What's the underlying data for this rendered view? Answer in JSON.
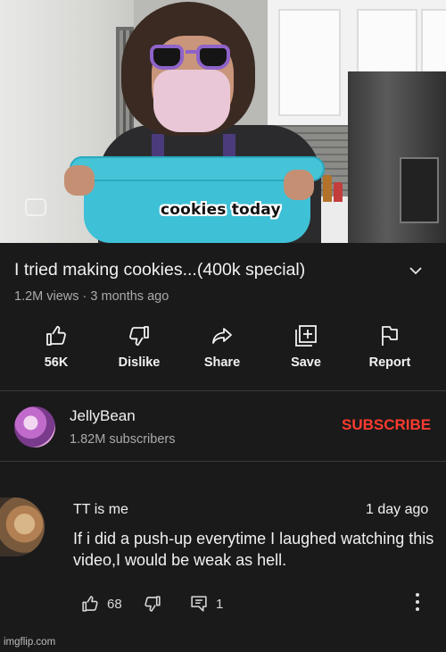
{
  "video": {
    "caption": "cookies today"
  },
  "details": {
    "title": "I tried making cookies...(400k special)",
    "meta": "1.2M views · 3 months ago"
  },
  "actions": [
    {
      "label": "56K",
      "icon": "thumbs-up-icon"
    },
    {
      "label": "Dislike",
      "icon": "thumbs-down-icon"
    },
    {
      "label": "Share",
      "icon": "share-arrow-icon"
    },
    {
      "label": "Save",
      "icon": "add-to-playlist-icon"
    },
    {
      "label": "Report",
      "icon": "flag-icon"
    }
  ],
  "channel": {
    "name": "JellyBean",
    "subscribers": "1.82M subscribers",
    "subscribe_label": "SUBSCRIBE",
    "subscribe_color": "#ff3b2f"
  },
  "comment": {
    "author": "TT is me",
    "time": "1 day ago",
    "text": "If i did a push-up everytime I laughed watching this video,I would be weak as hell.",
    "likes": "68",
    "replies": "1"
  },
  "watermark": "imgflip.com"
}
